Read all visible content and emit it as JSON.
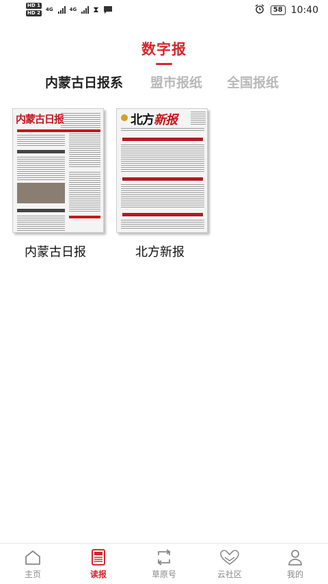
{
  "status_bar": {
    "sim1": "HD 1",
    "sim2": "HD 2",
    "net1": "4G",
    "net2": "4G",
    "battery": "58",
    "time": "10:40"
  },
  "header": {
    "title": "数字报"
  },
  "tabs": [
    {
      "label": "内蒙古日报系",
      "active": true
    },
    {
      "label": "盟市报纸",
      "active": false
    },
    {
      "label": "全国报纸",
      "active": false
    }
  ],
  "papers": [
    {
      "name": "内蒙古日报",
      "masthead": "内蒙古日报"
    },
    {
      "name": "北方新报",
      "masthead_a": "北方",
      "masthead_b": "新报"
    }
  ],
  "nav": [
    {
      "label": "主页",
      "icon": "home-icon",
      "active": false
    },
    {
      "label": "读报",
      "icon": "newspaper-icon",
      "active": true
    },
    {
      "label": "草原号",
      "icon": "repeat-icon",
      "active": false
    },
    {
      "label": "云社区",
      "icon": "community-heart-icon",
      "active": false
    },
    {
      "label": "我的",
      "icon": "user-icon",
      "active": false
    }
  ],
  "colors": {
    "accent": "#d7262e",
    "inactive_tab": "#b8b8b8",
    "nav_inactive": "#888888"
  }
}
